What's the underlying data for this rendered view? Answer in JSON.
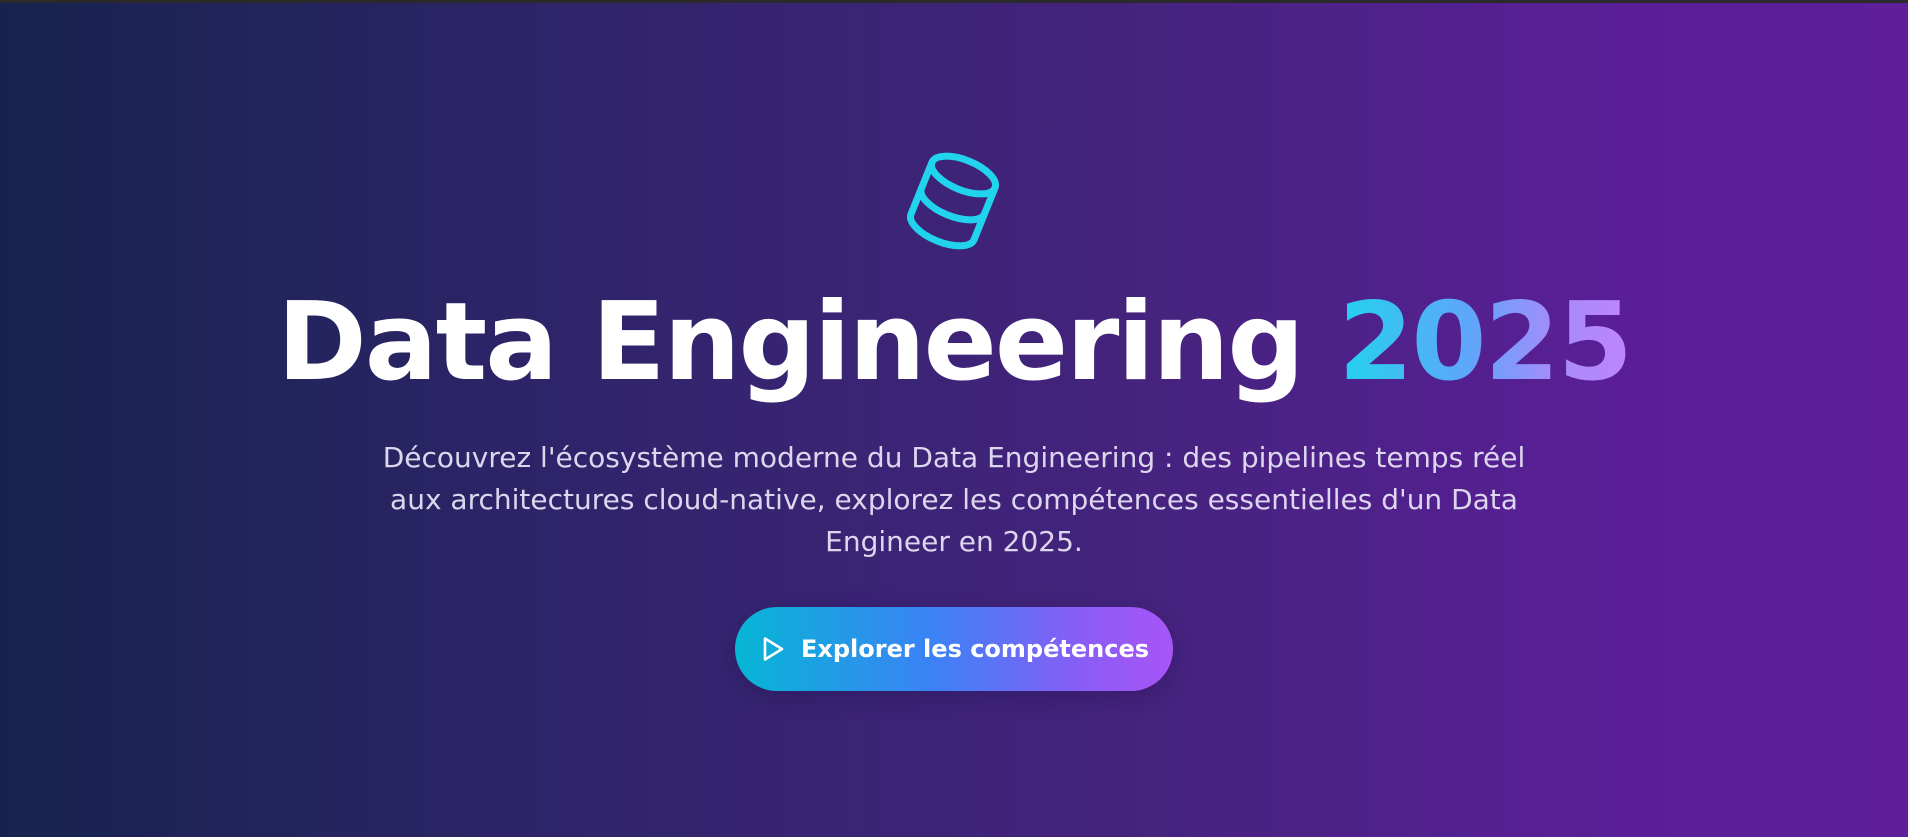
{
  "hero": {
    "icon": "database-icon",
    "title_main": "Data Engineering ",
    "title_accent": "2025",
    "subtitle": "Découvrez l'écosystème moderne du Data Engineering : des pipelines temps réel aux architectures cloud-native, explorez les compétences essentielles d'un Data Engineer en 2025.",
    "cta_label": "Explorer les compétences",
    "cta_icon": "play-icon",
    "colors": {
      "icon": "#22d3ee",
      "accent_start": "#22d3ee",
      "accent_end": "#c084fc",
      "background_start": "#17234f",
      "background_end": "#5e1f99"
    }
  }
}
